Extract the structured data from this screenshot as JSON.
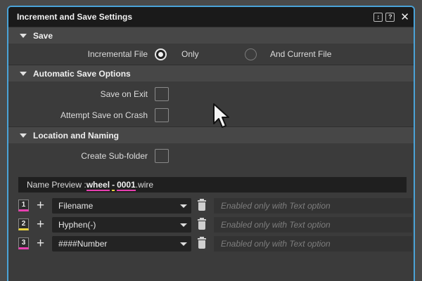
{
  "window": {
    "title": "Increment and Save Settings"
  },
  "titlebar_icons": [
    "dock-icon",
    "help-icon",
    "close-icon"
  ],
  "save": {
    "header": "Save",
    "incremental_label": "Incremental File",
    "options": [
      {
        "label": "Only",
        "checked": true
      },
      {
        "label": "And Current File",
        "checked": false
      }
    ]
  },
  "auto_save": {
    "header": "Automatic Save Options",
    "save_on_exit": "Save on Exit",
    "attempt_save_on_crash": "Attempt Save on Crash"
  },
  "location": {
    "header": "Location and Naming",
    "create_subfolder": "Create Sub-folder",
    "preview_label": "Name Preview :",
    "preview_tokens": [
      "wheel",
      "-",
      "0001",
      ".wire"
    ]
  },
  "name_parts": [
    {
      "num": "1",
      "value": "Filename",
      "text_placeholder": "Enabled only with Text option",
      "accent": "#e83fb0"
    },
    {
      "num": "2",
      "value": "Hyphen(-)",
      "text_placeholder": "Enabled only with Text option",
      "accent": "#e8d23f"
    },
    {
      "num": "3",
      "value": "####Number",
      "text_placeholder": "Enabled only with Text option",
      "accent": "#e83fb0"
    }
  ],
  "colors": {
    "accent_border": "#4aa3d8",
    "pink": "#e83fb0",
    "yellow": "#e8d23f"
  }
}
